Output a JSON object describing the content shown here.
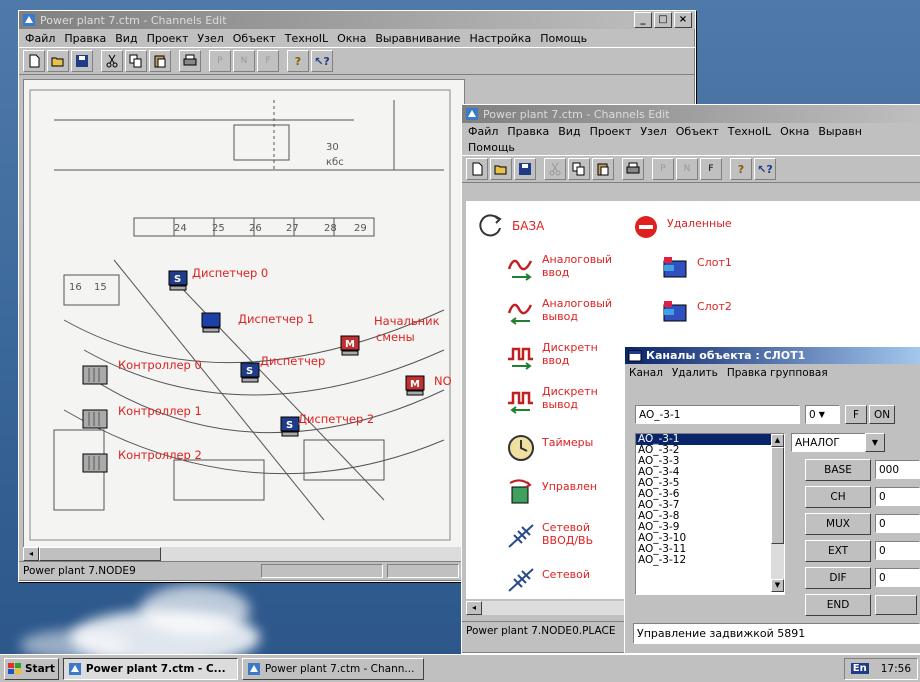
{
  "win1": {
    "title": "Power plant 7.ctm - Channels Edit",
    "menu": [
      "Файл",
      "Правка",
      "Вид",
      "Проект",
      "Узел",
      "Объект",
      "ТехноIL",
      "Окна",
      "Выравнивание",
      "Настройка",
      "Помощь"
    ],
    "plan_labels": {
      "disp0": "Диспетчер 0",
      "disp1": "Диспетчер 1",
      "chief": "Начальник",
      "chief2": "смены",
      "disp_mid": "Диспетчер",
      "disp2": "Диспетчер 2",
      "ctrl0": "Контроллер 0",
      "ctrl1": "Контроллер 1",
      "ctrl2": "Контроллер 2",
      "node_cut": "NO"
    },
    "status": "Power plant 7.NODE9"
  },
  "win2": {
    "title": "Power plant 7.ctm - Channels Edit",
    "menu": [
      "Файл",
      "Правка",
      "Вид",
      "Проект",
      "Узел",
      "Объект",
      "ТехноIL",
      "Окна",
      "Выравн"
    ],
    "menu2": "Помощь",
    "objects": {
      "base": "БАЗА",
      "deleted": "Удаленные",
      "ai1": "Аналоговый",
      "ai2": "ввод",
      "ao1": "Аналоговый",
      "ao2": "вывод",
      "di1": "Дискретн",
      "di2": "ввод",
      "do1": "Дискретн",
      "do2": "вывод",
      "timers": "Таймеры",
      "ctrl": "Управлен",
      "net1": "Сетевой",
      "net2": "ВВОД/ВЬ",
      "net3": "Сетевой",
      "slot1": "Слот1",
      "slot2": "Слот2"
    },
    "status": "Power plant 7.NODE0.PLACE"
  },
  "dialog": {
    "title": "Каналы объекта : СЛОТ1",
    "menu": [
      "Канал",
      "Удалить",
      "Правка групповая"
    ],
    "channel_field": "AO_-3-1",
    "num_select": "0",
    "btn_f": "F",
    "btn_on": "ON",
    "type_select": "АНАЛОГ",
    "channels": [
      "AO_-3-1",
      "AO_-3-2",
      "AO_-3-3",
      "AO_-3-4",
      "AO_-3-5",
      "AO_-3-6",
      "AO_-3-7",
      "AO_-3-8",
      "AO_-3-9",
      "AO_-3-10",
      "AO_-3-11",
      "AO_-3-12"
    ],
    "params": [
      {
        "label": "BASE",
        "value": "000"
      },
      {
        "label": "CH",
        "value": "0"
      },
      {
        "label": "MUX",
        "value": "0"
      },
      {
        "label": "EXT",
        "value": "0"
      },
      {
        "label": "DIF",
        "value": "0"
      },
      {
        "label": "END",
        "value": ""
      }
    ],
    "description": "Управление задвижкой 5891"
  },
  "taskbar": {
    "start": "Start",
    "task1": "Power plant 7.ctm - C...",
    "task2": "Power plant 7.ctm - Chann...",
    "lang": "En",
    "time": "17:56"
  }
}
